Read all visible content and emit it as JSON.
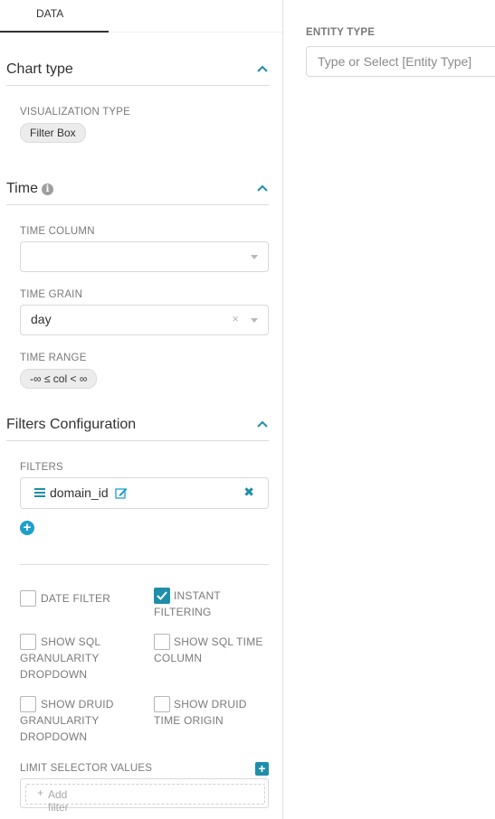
{
  "tabs": {
    "data_label": "DATA"
  },
  "chart_type_section": {
    "title": "Chart type",
    "viz_type_label": "VISUALIZATION TYPE",
    "viz_type_value": "Filter Box"
  },
  "time_section": {
    "title": "Time",
    "time_column_label": "TIME COLUMN",
    "time_column_value": "",
    "time_grain_label": "TIME GRAIN",
    "time_grain_value": "day",
    "time_range_label": "TIME RANGE",
    "time_range_value": "-∞ ≤ col < ∞"
  },
  "filters_section": {
    "title": "Filters Configuration",
    "filters_label": "FILTERS",
    "filters": [
      {
        "name": "domain_id"
      }
    ],
    "options": {
      "date_filter": {
        "label": "DATE FILTER",
        "checked": false
      },
      "instant_filtering": {
        "label_line1": "INSTANT",
        "label_line2": "FILTERING",
        "checked": true
      },
      "show_sql_granularity": {
        "label_line1": "SHOW SQL",
        "label_line2": "GRANULARITY",
        "label_line3": "DROPDOWN",
        "checked": false
      },
      "show_sql_time_column": {
        "label_line1": "SHOW SQL TIME",
        "label_line2": "COLUMN",
        "checked": false
      },
      "show_druid_granularity": {
        "label_line1": "SHOW DRUID",
        "label_line2": "GRANULARITY",
        "label_line3": "DROPDOWN",
        "checked": false
      },
      "show_druid_time_origin": {
        "label_line1": "SHOW DRUID",
        "label_line2": "TIME ORIGIN",
        "checked": false
      }
    },
    "limit_selector_label": "LIMIT SELECTOR VALUES",
    "add_filter_placeholder": "Add filter"
  },
  "right_panel": {
    "entity_type_label": "ENTITY TYPE",
    "entity_type_placeholder": "Type or Select [Entity Type]"
  },
  "colors": {
    "accent": "#1f8ea8",
    "add_icon": "#1f9fcb",
    "label_gray": "#7a7a7a"
  },
  "icons": [
    "chevron-up-icon",
    "info-icon",
    "caret-down-icon",
    "clear-icon",
    "drag-handle-icon",
    "edit-icon",
    "remove-icon",
    "add-circle-icon",
    "checkmark-icon",
    "plus-icon"
  ]
}
